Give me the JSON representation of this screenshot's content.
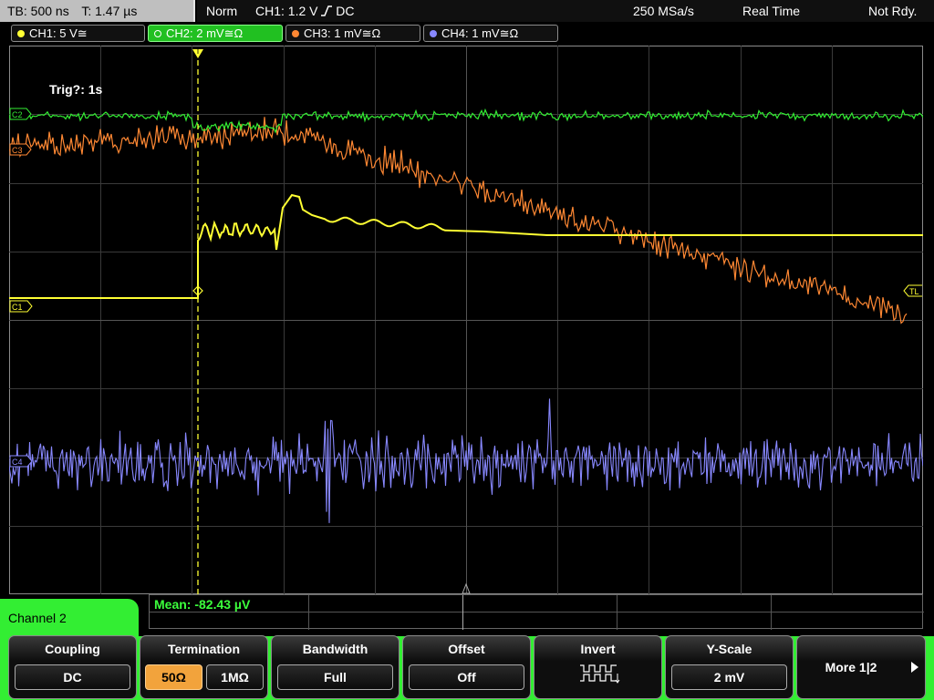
{
  "status": {
    "timebase": "TB: 500 ns",
    "trigger_time": "T: 1.47 µs",
    "mode": "Norm",
    "trigger": "CH1: 1.2 V",
    "trigger_slope_icon": "rising-edge-icon",
    "trigger_coupling": "DC",
    "sample_rate": "250 MSa/s",
    "acq_mode": "Real Time",
    "ready": "Not Rdy."
  },
  "channels": [
    {
      "label": "CH1: 5 V",
      "coupling_icon": "dc-coupling-icon",
      "suffix": "≅",
      "color": "#ffff33",
      "active": false
    },
    {
      "label": "CH2: 2 mV",
      "coupling_icon": "dc-coupling-icon",
      "suffix": "≅Ω",
      "color": "#33ee33",
      "active": true
    },
    {
      "label": "CH3: 1 mV",
      "coupling_icon": "dc-coupling-icon",
      "suffix": "≅Ω",
      "color": "#ff8833",
      "active": false
    },
    {
      "label": "CH4: 1 mV",
      "coupling_icon": "dc-coupling-icon",
      "suffix": "≅Ω",
      "color": "#8888ff",
      "active": false
    }
  ],
  "display": {
    "trigger_info": "Trig?: 1s",
    "markers": {
      "c2": "C2",
      "c3": "C3",
      "c1": "C1",
      "c4": "C4",
      "trigger_level": "TL"
    }
  },
  "measurement": {
    "text": "Mean: -82.43 µV"
  },
  "menu": {
    "channel_label": "Channel 2",
    "coupling": {
      "title": "Coupling",
      "value": "DC"
    },
    "termination": {
      "title": "Termination",
      "option1": "50Ω",
      "option2": "1MΩ",
      "selected": "50Ω"
    },
    "bandwidth": {
      "title": "Bandwidth",
      "value": "Full"
    },
    "offset": {
      "title": "Offset",
      "value": "Off"
    },
    "invert": {
      "title": "Invert",
      "icon": "invert-waveform-icon"
    },
    "yscale": {
      "title": "Y-Scale",
      "value": "2 mV"
    },
    "more": {
      "label": "More 1|2",
      "icon": "arrow-right-icon"
    }
  },
  "colors": {
    "ch1": "#ffff33",
    "ch2": "#33ee33",
    "ch3": "#ff8833",
    "ch4": "#8888ff",
    "menu_green": "#33ee33",
    "selected_orange": "#f2a33c"
  }
}
